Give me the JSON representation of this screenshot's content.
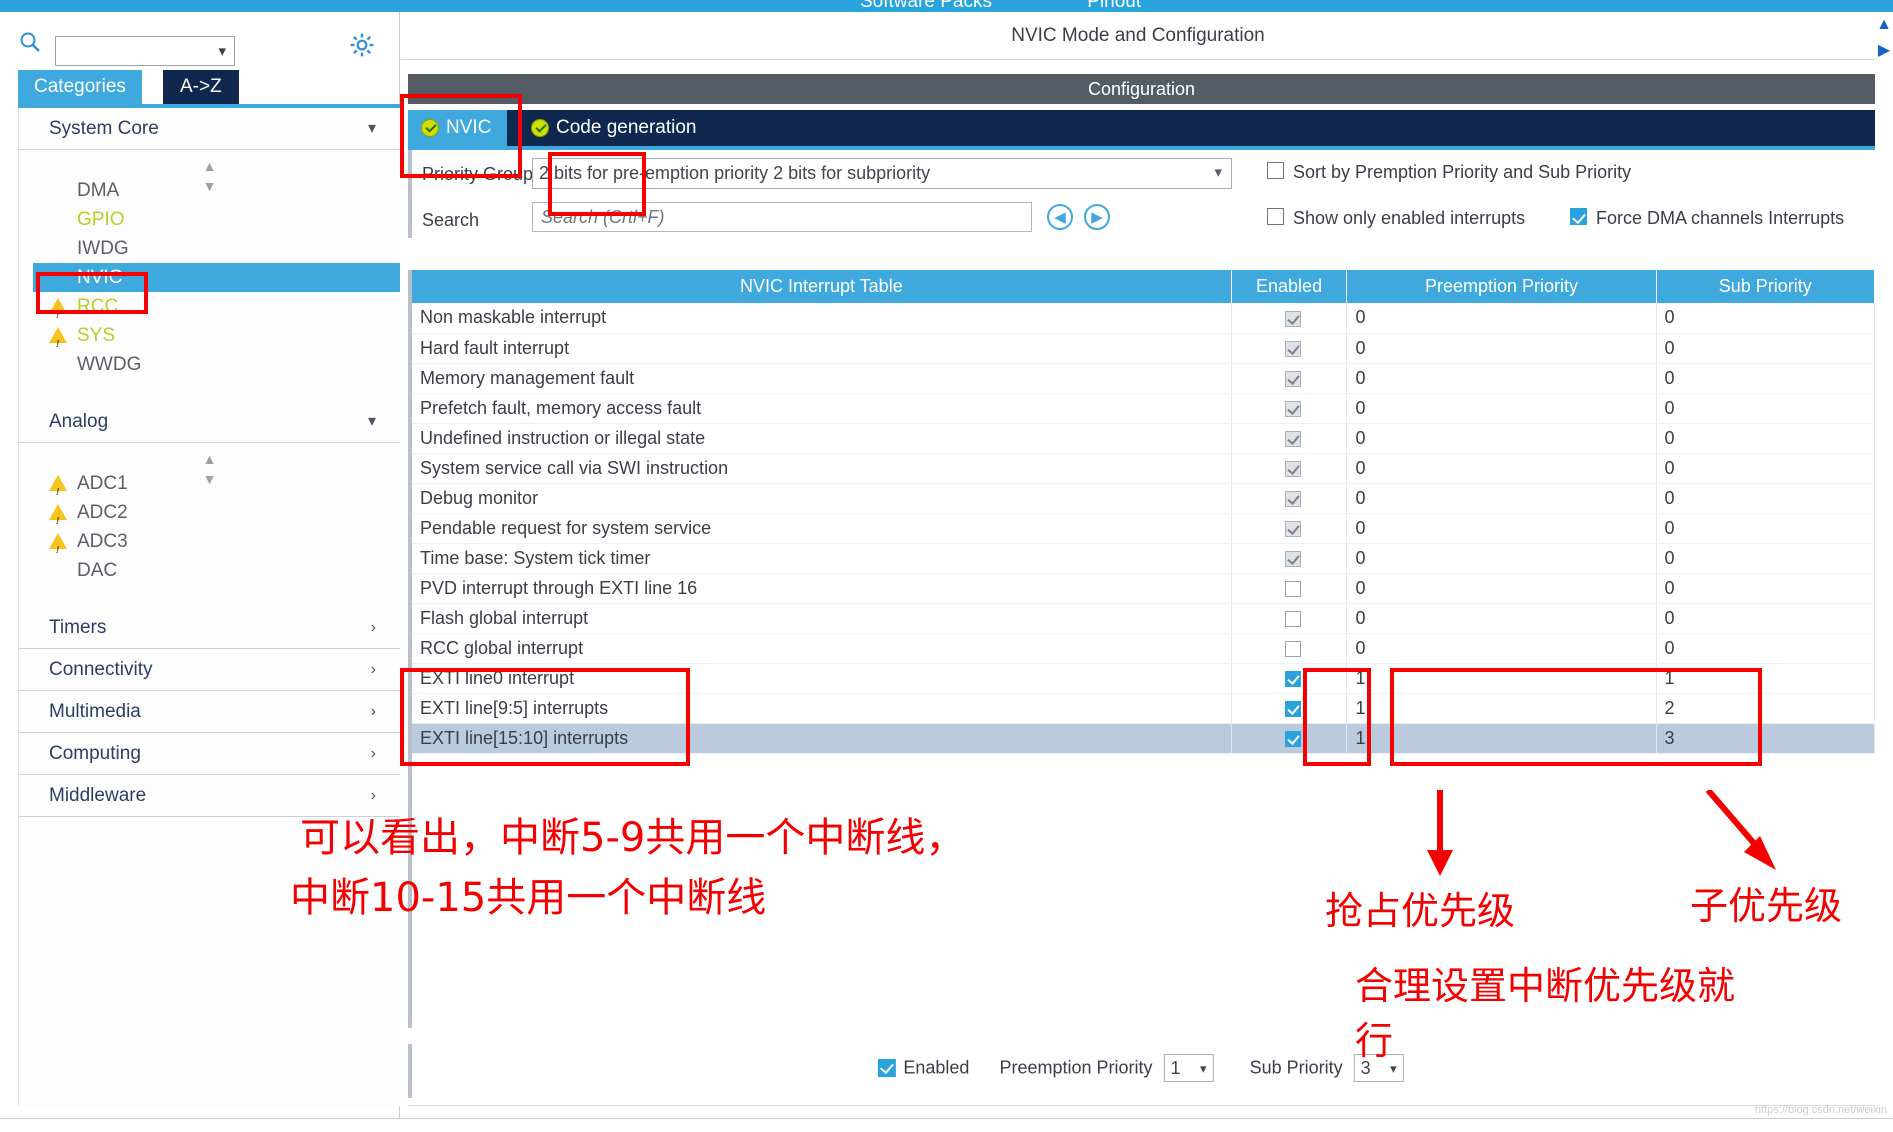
{
  "top": {
    "tabs": [
      "Software Packs",
      "Pinout"
    ]
  },
  "sidebar": {
    "search_placeholder": "",
    "tabs": [
      {
        "label": "Categories",
        "active": true
      },
      {
        "label": "A->Z",
        "active": false
      }
    ],
    "groups": [
      {
        "title": "System Core",
        "expanded": true,
        "items": [
          {
            "label": "DMA",
            "state": "normal",
            "selected": false
          },
          {
            "label": "GPIO",
            "state": "green",
            "selected": false
          },
          {
            "label": "IWDG",
            "state": "normal",
            "selected": false
          },
          {
            "label": "NVIC",
            "state": "normal",
            "selected": true
          },
          {
            "label": "RCC",
            "state": "green",
            "selected": false,
            "warning": true
          },
          {
            "label": "SYS",
            "state": "green",
            "selected": false,
            "warning": true
          },
          {
            "label": "WWDG",
            "state": "normal",
            "selected": false
          }
        ]
      },
      {
        "title": "Analog",
        "expanded": true,
        "items": [
          {
            "label": "ADC1",
            "state": "normal",
            "selected": false,
            "warning": true
          },
          {
            "label": "ADC2",
            "state": "normal",
            "selected": false,
            "warning": true
          },
          {
            "label": "ADC3",
            "state": "normal",
            "selected": false,
            "warning": true
          },
          {
            "label": "DAC",
            "state": "normal",
            "selected": false
          }
        ]
      },
      {
        "title": "Timers",
        "expanded": false,
        "items": []
      },
      {
        "title": "Connectivity",
        "expanded": false,
        "items": []
      },
      {
        "title": "Multimedia",
        "expanded": false,
        "items": []
      },
      {
        "title": "Computing",
        "expanded": false,
        "items": []
      },
      {
        "title": "Middleware",
        "expanded": false,
        "items": []
      }
    ]
  },
  "main": {
    "mode_title": "NVIC Mode and Configuration",
    "config_bar": "Configuration",
    "tabs": [
      {
        "label": "NVIC",
        "active": true
      },
      {
        "label": "Code generation",
        "active": false
      }
    ],
    "priority_group": {
      "label": "Priority Group",
      "value": "2 bits for pre-emption priority 2 bits for subpriority"
    },
    "search": {
      "label": "Search",
      "placeholder": "Search (Crtl+F)",
      "prev_icon": "chevron-left-circle-icon",
      "next_icon": "chevron-right-circle-icon"
    },
    "checkboxes": {
      "sort": {
        "label": "Sort by Premption Priority and Sub Priority",
        "checked": false
      },
      "show_enabled": {
        "label": "Show only enabled interrupts",
        "checked": false
      },
      "force_dma": {
        "label": "Force DMA channels Interrupts",
        "checked": true
      }
    },
    "table": {
      "headers": [
        "NVIC Interrupt Table",
        "Enabled",
        "Preemption Priority",
        "Sub Priority"
      ],
      "rows": [
        {
          "name": "Non maskable interrupt",
          "enabled": "locked",
          "pre": "0",
          "sub": "0",
          "dim": true,
          "selected": false
        },
        {
          "name": "Hard fault interrupt",
          "enabled": "locked",
          "pre": "0",
          "sub": "0",
          "dim": true,
          "selected": false
        },
        {
          "name": "Memory management fault",
          "enabled": "locked",
          "pre": "0",
          "sub": "0",
          "dim": false,
          "selected": false
        },
        {
          "name": "Prefetch fault, memory access fault",
          "enabled": "locked",
          "pre": "0",
          "sub": "0",
          "dim": false,
          "selected": false
        },
        {
          "name": "Undefined instruction or illegal state",
          "enabled": "locked",
          "pre": "0",
          "sub": "0",
          "dim": false,
          "selected": false
        },
        {
          "name": "System service call via SWI instruction",
          "enabled": "locked",
          "pre": "0",
          "sub": "0",
          "dim": false,
          "selected": false
        },
        {
          "name": "Debug monitor",
          "enabled": "locked",
          "pre": "0",
          "sub": "0",
          "dim": false,
          "selected": false
        },
        {
          "name": "Pendable request for system service",
          "enabled": "locked",
          "pre": "0",
          "sub": "0",
          "dim": false,
          "selected": false
        },
        {
          "name": "Time base: System tick timer",
          "enabled": "locked",
          "pre": "0",
          "sub": "0",
          "dim": false,
          "selected": false
        },
        {
          "name": "PVD interrupt through EXTI line 16",
          "enabled": "off",
          "pre": "0",
          "sub": "0",
          "dim": false,
          "selected": false
        },
        {
          "name": "Flash global interrupt",
          "enabled": "off",
          "pre": "0",
          "sub": "0",
          "dim": false,
          "selected": false
        },
        {
          "name": "RCC global interrupt",
          "enabled": "off",
          "pre": "0",
          "sub": "0",
          "dim": false,
          "selected": false
        },
        {
          "name": "EXTI line0 interrupt",
          "enabled": "on",
          "pre": "1",
          "sub": "1",
          "dim": false,
          "selected": false
        },
        {
          "name": "EXTI line[9:5] interrupts",
          "enabled": "on",
          "pre": "1",
          "sub": "2",
          "dim": false,
          "selected": false
        },
        {
          "name": "EXTI line[15:10] interrupts",
          "enabled": "on",
          "pre": "1",
          "sub": "3",
          "dim": false,
          "selected": true
        }
      ]
    },
    "footer": {
      "enabled_label": "Enabled",
      "enabled_checked": true,
      "preemption_label": "Preemption Priority",
      "preemption_value": "1",
      "sub_label": "Sub Priority",
      "sub_value": "3"
    }
  },
  "annotations": {
    "note_line1": "可以看出，中断5-9共用一个中断线，",
    "note_line2": "中断10-15共用一个中断线",
    "preemption_note": "抢占优先级",
    "sub_note": "子优先级",
    "advice_line1": "合理设置中断优先级就",
    "advice_line2": "行",
    "color": "#f40000"
  }
}
